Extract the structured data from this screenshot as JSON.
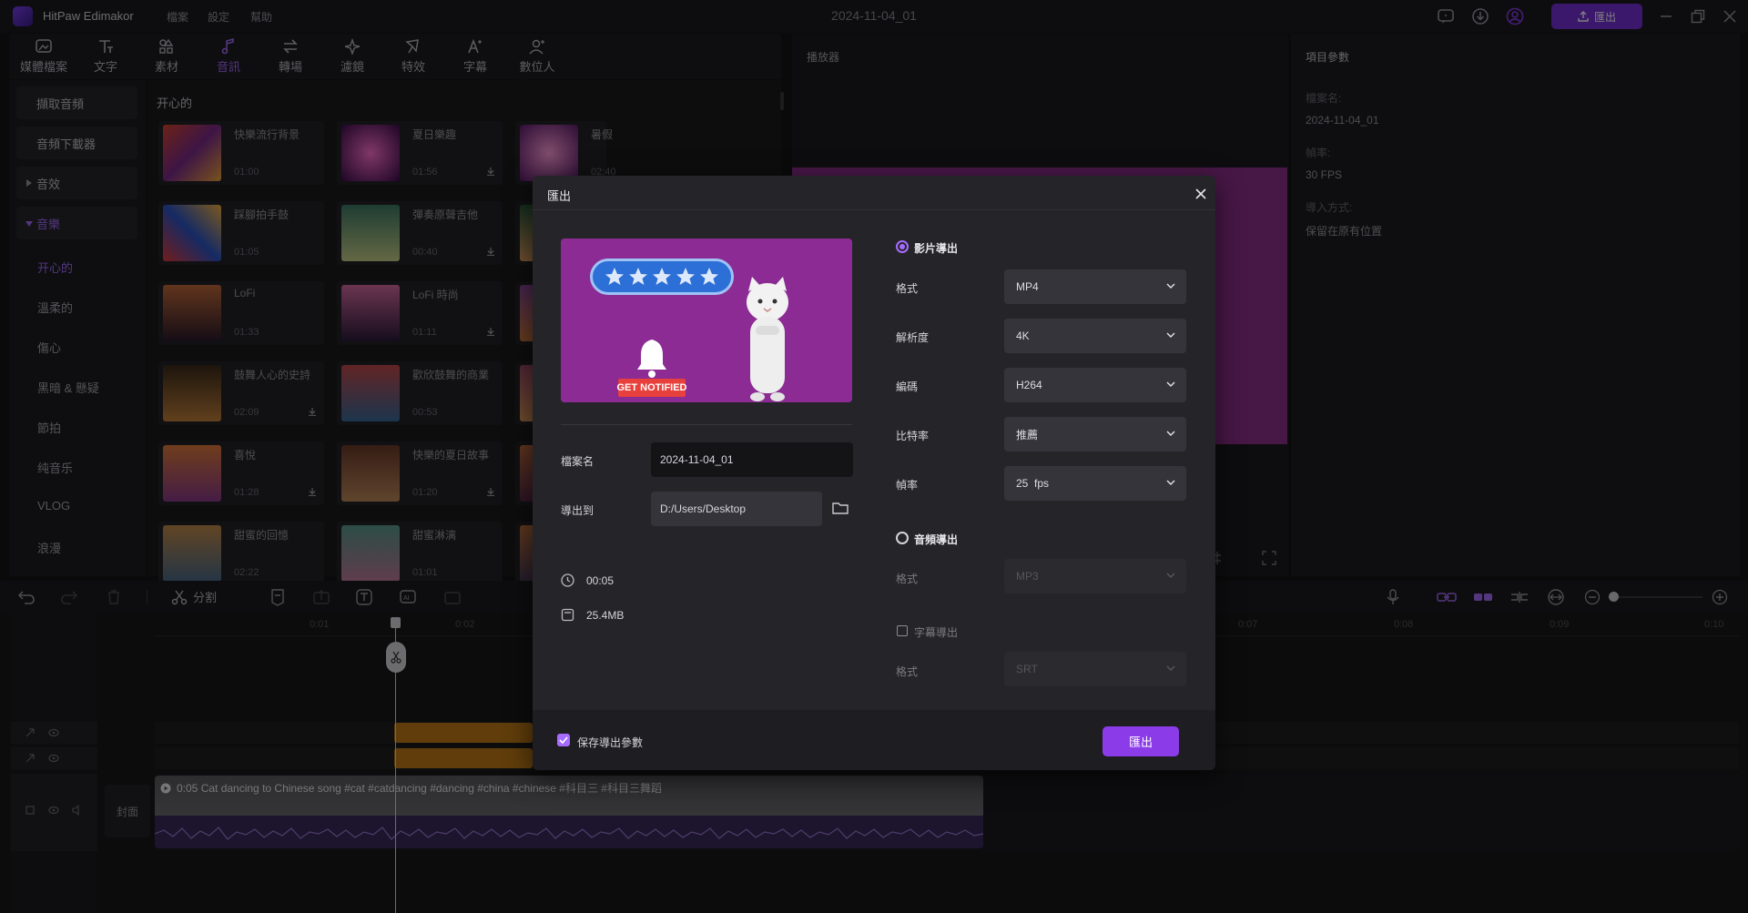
{
  "app": {
    "name": "HitPaw Edimakor",
    "project_title": "2024-11-04_01",
    "export_label": "匯出"
  },
  "menu": [
    "檔案",
    "設定",
    "幫助"
  ],
  "toolbar": [
    "媒體檔案",
    "文字",
    "素材",
    "音訊",
    "轉場",
    "濾鏡",
    "特效",
    "字幕",
    "數位人"
  ],
  "leftnav": {
    "buttons": [
      "擷取音頻",
      "音頻下載器",
      "音效",
      "音樂"
    ],
    "sub_items": [
      "开心的",
      "溫柔的",
      "傷心",
      "黑暗 & 懸疑",
      "節拍",
      "纯音乐",
      "VLOG",
      "浪漫"
    ]
  },
  "library": {
    "heading": "开心的",
    "cards": [
      {
        "title": "快樂流行背景",
        "duration": "01:00"
      },
      {
        "title": "夏日樂趣",
        "duration": "01:56"
      },
      {
        "title": "暑假",
        "duration": "02:40"
      },
      {
        "title": "踩腳拍手鼓",
        "duration": "01:05"
      },
      {
        "title": "彈奏原聲吉他",
        "duration": "00:40"
      },
      {
        "title": "",
        "duration": ""
      },
      {
        "title": "LoFi",
        "duration": "01:33"
      },
      {
        "title": "LoFi 時尚",
        "duration": "01:11"
      },
      {
        "title": "",
        "duration": ""
      },
      {
        "title": "鼓舞人心的史詩",
        "duration": "02:09"
      },
      {
        "title": "歡欣鼓舞的商業",
        "duration": "00:53"
      },
      {
        "title": "",
        "duration": ""
      },
      {
        "title": "喜悅",
        "duration": "01:28"
      },
      {
        "title": "快樂的夏日故事",
        "duration": "01:20"
      },
      {
        "title": "",
        "duration": ""
      },
      {
        "title": "甜蜜的回憶",
        "duration": "02:22"
      },
      {
        "title": "甜蜜淋漓",
        "duration": "01:01"
      },
      {
        "title": "",
        "duration": ""
      }
    ]
  },
  "player": {
    "label": "播放器"
  },
  "params": {
    "title": "項目參數",
    "name_label": "檔案名:",
    "name_value": "2024-11-04_01",
    "fps_label": "幀率:",
    "fps_value": "30 FPS",
    "import_label": "導入方式:",
    "import_value": "保留在原有位置"
  },
  "timeline": {
    "split_label": "分割",
    "ruler": [
      "0:01",
      "0:02",
      "0:07",
      "0:08",
      "0:09",
      "0:10"
    ],
    "cover_label": "封面",
    "clip_text": "0:05 Cat dancing to Chinese song #cat #catdancing #dancing #china #chinese #科目三 #科目三舞蹈"
  },
  "dialog": {
    "title": "匯出",
    "thumb_badge": "GET NOTIFIED",
    "filename_label": "檔案名",
    "filename_value": "2024-11-04_01",
    "export_to_label": "導出到",
    "export_to_value": "D:/Users/Desktop",
    "duration": "00:05",
    "size": "25.4MB",
    "video_export_label": "影片導出",
    "format_label": "格式",
    "format_value": "MP4",
    "resolution_label": "解析度",
    "resolution_value": "4K",
    "codec_label": "編碼",
    "codec_value": "H264",
    "bitrate_label": "比特率",
    "bitrate_value": "推薦",
    "framerate_label": "幀率",
    "framerate_value": "25  fps",
    "audio_export_label": "音頻導出",
    "audio_format_label": "格式",
    "audio_format_value": "MP3",
    "subtitle_export_label": "字幕導出",
    "subtitle_format_label": "格式",
    "subtitle_format_value": "SRT",
    "save_params_label": "保存導出參數",
    "export_button": "匯出"
  },
  "colors": {
    "accent": "#8b3ce8",
    "preview_bg": "#8e2f8c"
  }
}
